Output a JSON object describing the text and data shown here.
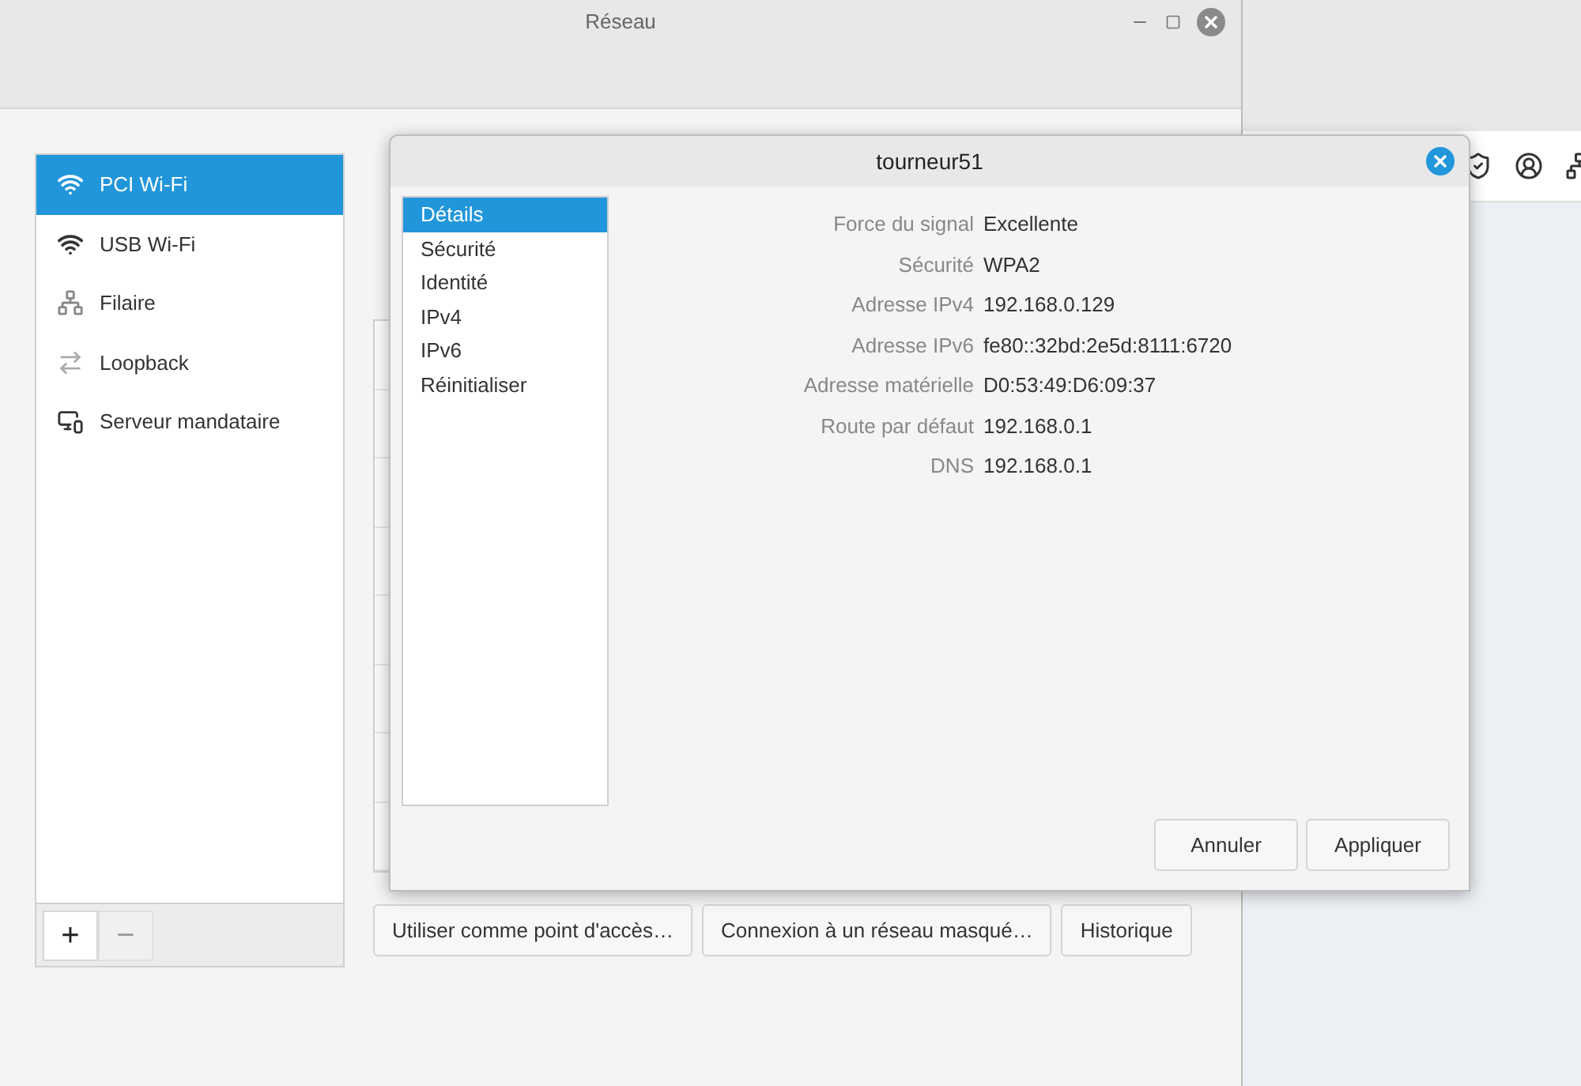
{
  "window": {
    "title": "Réseau"
  },
  "sidebar": {
    "items": [
      {
        "kind": "wifi",
        "label": "PCI Wi-Fi",
        "selected": true
      },
      {
        "kind": "wifi",
        "label": "USB Wi-Fi",
        "selected": false
      },
      {
        "kind": "wired",
        "label": "Filaire",
        "selected": false
      },
      {
        "kind": "loopback",
        "label": "Loopback",
        "selected": false
      },
      {
        "kind": "proxy",
        "label": "Serveur mandataire",
        "selected": false
      }
    ],
    "add_button": "+",
    "remove_button": "−"
  },
  "bottom_buttons": [
    "Utiliser comme point d'accès…",
    "Connexion à un réseau masqué…",
    "Historique"
  ],
  "dialog": {
    "title": "tourneur51",
    "pages": [
      {
        "label": "Détails",
        "selected": true
      },
      {
        "label": "Sécurité",
        "selected": false
      },
      {
        "label": "Identité",
        "selected": false
      },
      {
        "label": "IPv4",
        "selected": false
      },
      {
        "label": "IPv6",
        "selected": false
      },
      {
        "label": "Réinitialiser",
        "selected": false
      }
    ],
    "details": [
      {
        "label": "Force du signal",
        "value": "Excellente"
      },
      {
        "label": "Sécurité",
        "value": "WPA2"
      },
      {
        "label": "Adresse IPv4",
        "value": "192.168.0.129"
      },
      {
        "label": "Adresse IPv6",
        "value": "fe80::32bd:2e5d:8111:6720"
      },
      {
        "label": "Adresse matérielle",
        "value": "D0:53:49:D6:09:37"
      },
      {
        "label": "Route par défaut",
        "value": "192.168.0.1"
      },
      {
        "label": "DNS",
        "value": "192.168.0.1"
      }
    ],
    "buttons": [
      "Annuler",
      "Appliquer"
    ]
  }
}
